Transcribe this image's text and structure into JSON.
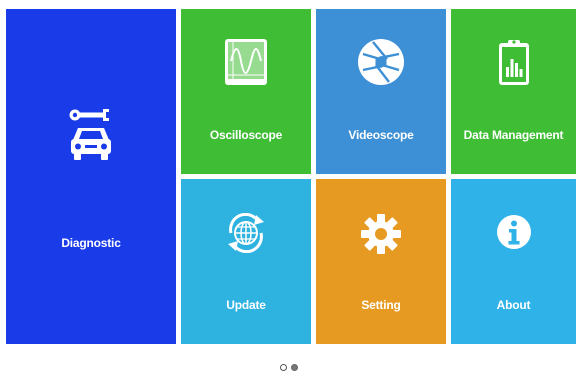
{
  "colors": {
    "diagnostic": "#1a3be8",
    "oscilloscope": "#3fbe35",
    "videoscope": "#3d8fd6",
    "data_management": "#3fbe35",
    "update": "#2eb2e0",
    "setting": "#e79a22",
    "about": "#2eb2e8",
    "icon_fill": "#ffffff"
  },
  "tiles": {
    "diagnostic": {
      "label": "Diagnostic",
      "icon": "car-wrench-icon"
    },
    "oscilloscope": {
      "label": "Oscilloscope",
      "icon": "waveform-icon"
    },
    "videoscope": {
      "label": "Videoscope",
      "icon": "camera-aperture-icon"
    },
    "data_management": {
      "label": "Data Management",
      "icon": "clipboard-chart-icon"
    },
    "update": {
      "label": "Update",
      "icon": "globe-refresh-icon"
    },
    "setting": {
      "label": "Setting",
      "icon": "gear-icon"
    },
    "about": {
      "label": "About",
      "icon": "info-icon"
    }
  },
  "pager": {
    "pages": 2,
    "current": 2
  }
}
